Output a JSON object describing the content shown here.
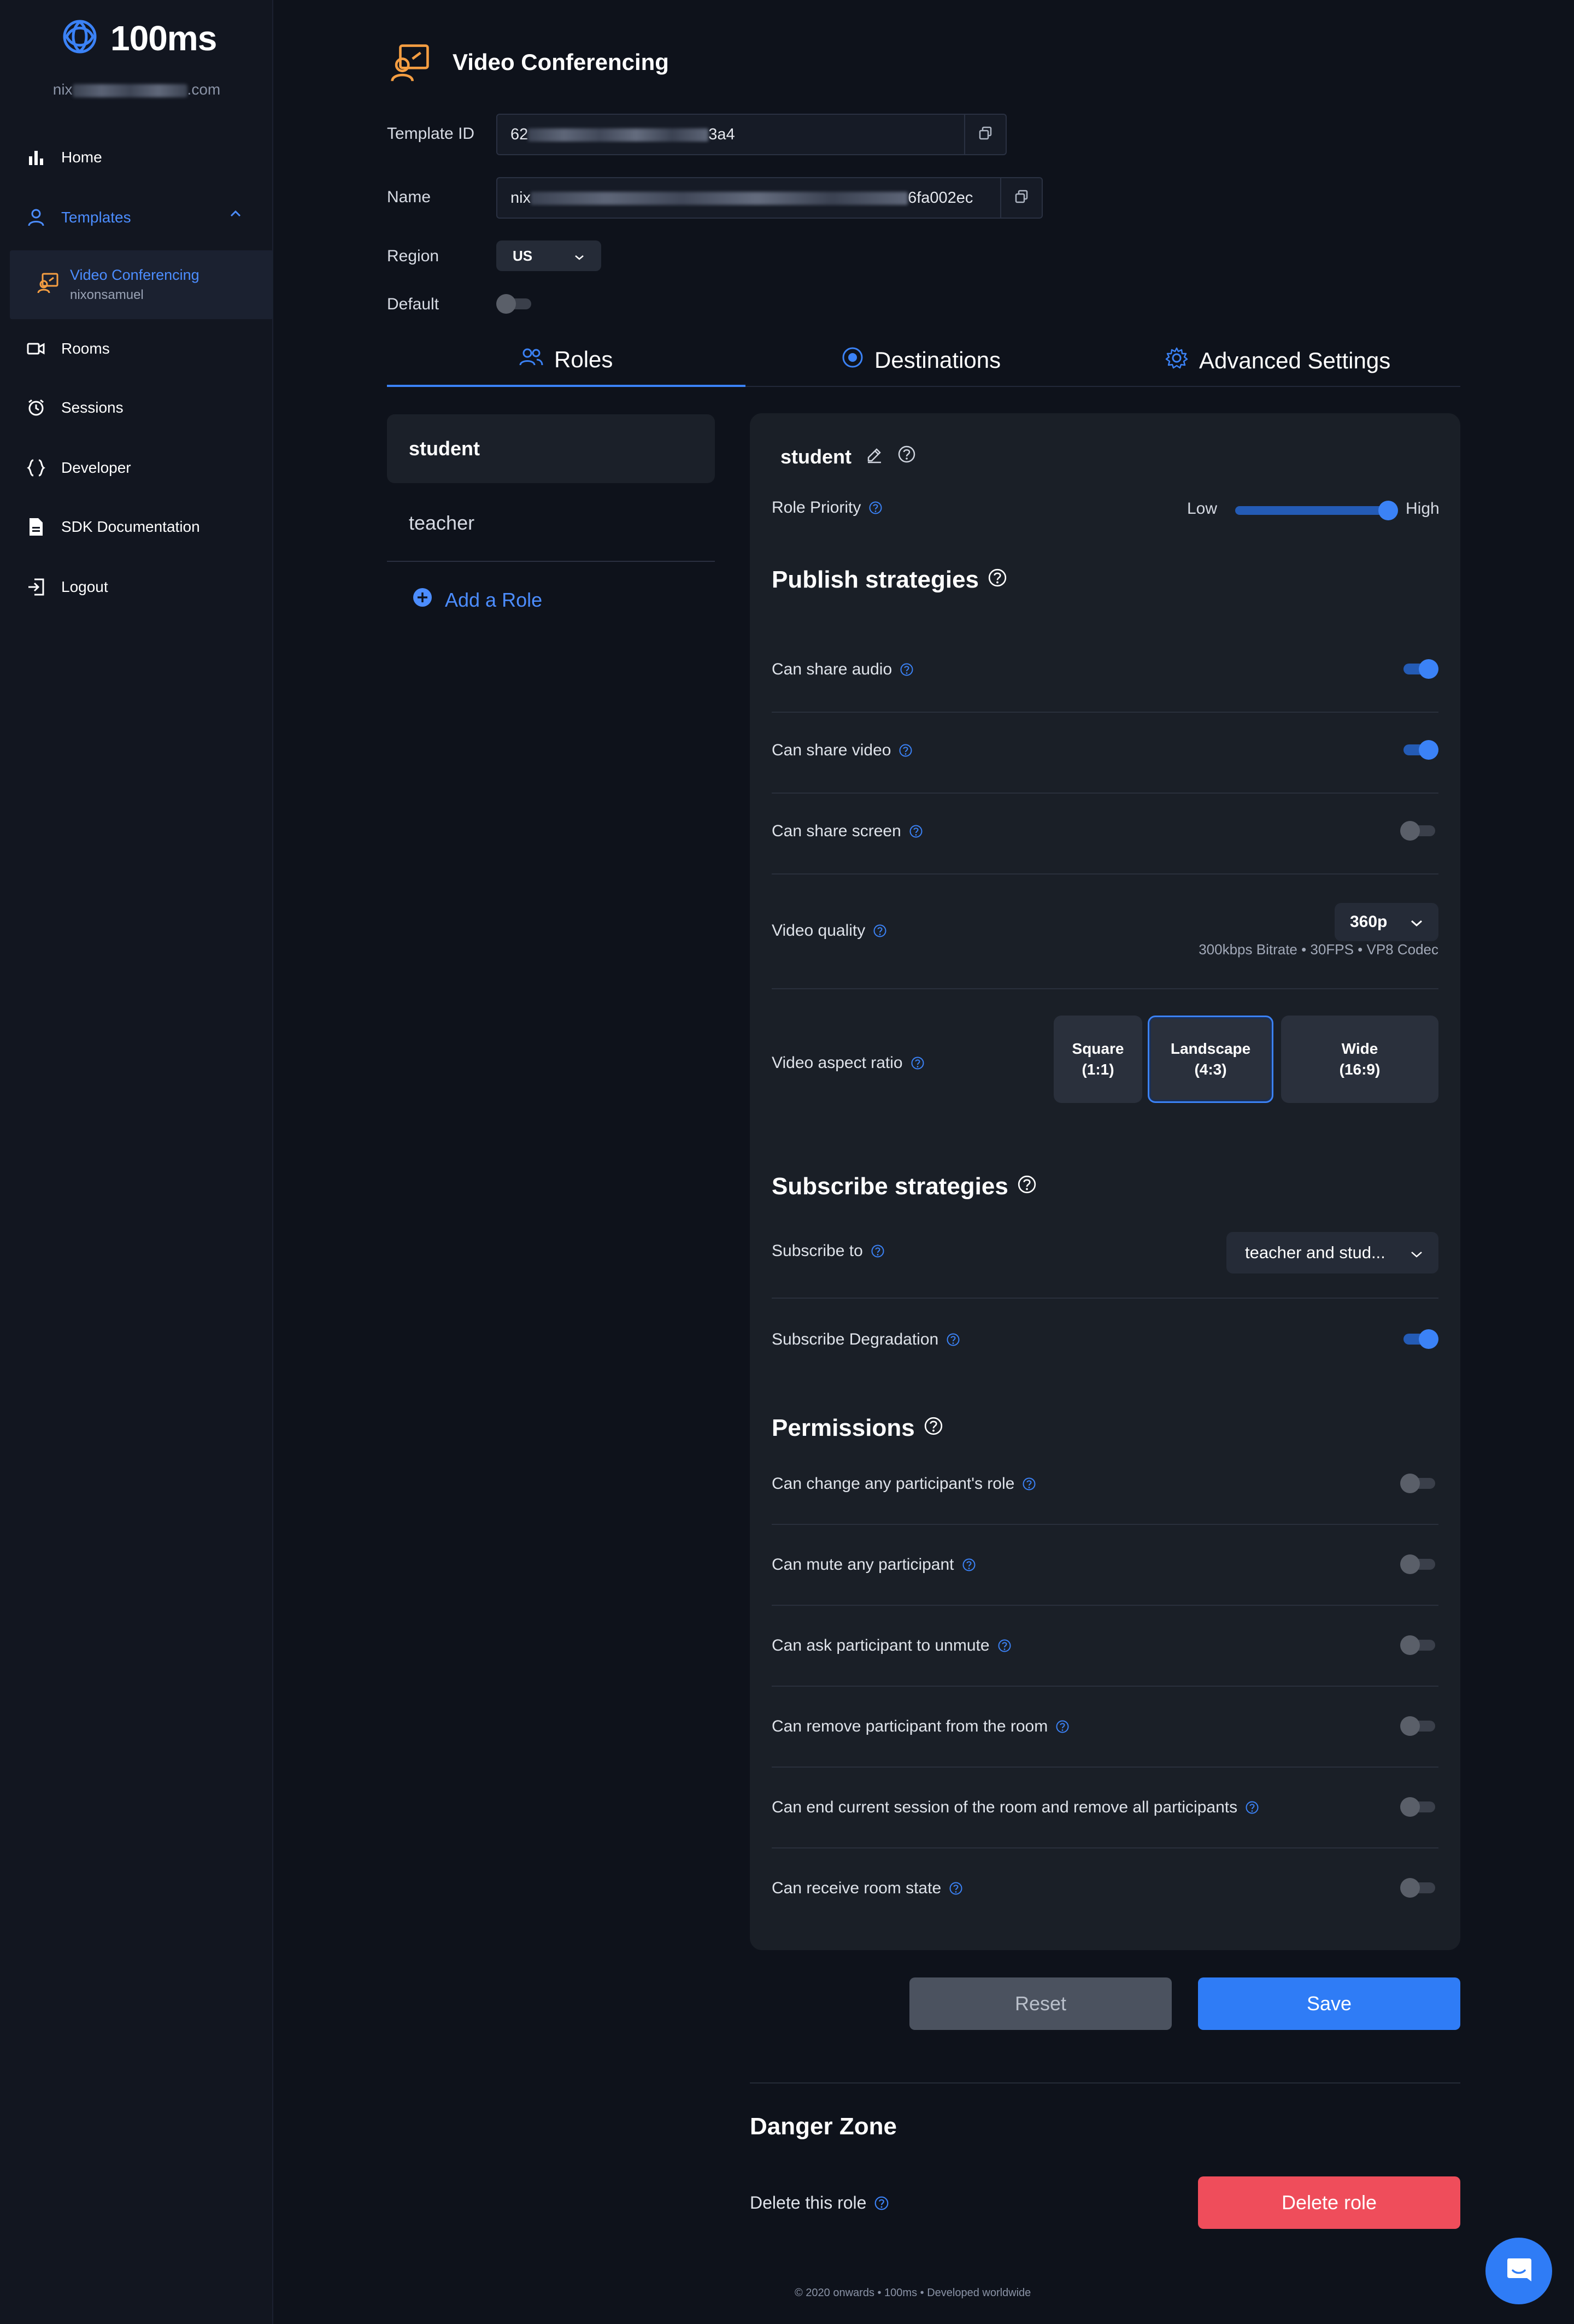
{
  "colors": {
    "accent": "#3b82f6",
    "danger": "#ef4d5b",
    "brand_icon": "#f59e42",
    "background": "#0e121b",
    "panel": "#1a1f27"
  },
  "sidebar": {
    "brand": "100ms",
    "email_prefix": "nix",
    "email_suffix": ".com",
    "items": [
      {
        "label": "Home",
        "icon": "bar-chart-icon"
      },
      {
        "label": "Templates",
        "icon": "user-icon"
      },
      {
        "label": "Rooms",
        "icon": "video-icon"
      },
      {
        "label": "Sessions",
        "icon": "alarm-clock-icon"
      },
      {
        "label": "Developer",
        "icon": "braces-icon"
      },
      {
        "label": "SDK Documentation",
        "icon": "document-icon"
      },
      {
        "label": "Logout",
        "icon": "logout-icon"
      }
    ],
    "template_sub": {
      "title": "Video Conferencing",
      "owner": "nixonsamuel"
    }
  },
  "header": {
    "title": "Video Conferencing"
  },
  "fields": {
    "template_id_label": "Template ID",
    "template_id_prefix": "62",
    "template_id_suffix": "3a4",
    "name_label": "Name",
    "name_prefix": "nix",
    "name_suffix": "6fa002ec",
    "region_label": "Region",
    "region_value": "US",
    "default_label": "Default",
    "default_on": false
  },
  "tabs": [
    {
      "label": "Roles",
      "icon": "users-icon",
      "active": true
    },
    {
      "label": "Destinations",
      "icon": "record-icon",
      "active": false
    },
    {
      "label": "Advanced Settings",
      "icon": "gear-icon",
      "active": false
    }
  ],
  "roles": {
    "items": [
      "student",
      "teacher"
    ],
    "selected": "student",
    "add_label": "Add a Role"
  },
  "role_panel": {
    "role_name": "student",
    "priority": {
      "label": "Role Priority",
      "low": "Low",
      "high": "High",
      "level": 1.0
    },
    "publish": {
      "title": "Publish strategies",
      "can_share_audio": {
        "label": "Can share audio",
        "on": true
      },
      "can_share_video": {
        "label": "Can share video",
        "on": true
      },
      "can_share_screen": {
        "label": "Can share screen",
        "on": false
      },
      "video_quality": {
        "label": "Video quality",
        "value": "360p",
        "info": "300kbps Bitrate • 30FPS • VP8 Codec"
      },
      "aspect_ratio": {
        "label": "Video aspect ratio",
        "options": [
          {
            "line1": "Square",
            "line2": "(1:1)"
          },
          {
            "line1": "Landscape",
            "line2": "(4:3)"
          },
          {
            "line1": "Wide",
            "line2": "(16:9)"
          }
        ],
        "selected": "Landscape"
      }
    },
    "subscribe": {
      "title": "Subscribe strategies",
      "subscribe_to": {
        "label": "Subscribe to",
        "value": "teacher and stud..."
      },
      "degradation": {
        "label": "Subscribe Degradation",
        "on": true
      }
    },
    "permissions": {
      "title": "Permissions",
      "items": [
        {
          "label": "Can change any participant's role",
          "on": false
        },
        {
          "label": "Can mute any participant",
          "on": false
        },
        {
          "label": "Can ask participant to unmute",
          "on": false
        },
        {
          "label": "Can remove participant from the room",
          "on": false
        },
        {
          "label": "Can end current session of the room and remove all participants",
          "on": false
        },
        {
          "label": "Can receive room state",
          "on": false
        }
      ]
    }
  },
  "actions": {
    "reset": "Reset",
    "save": "Save"
  },
  "danger_zone": {
    "title": "Danger Zone",
    "label": "Delete this role",
    "button": "Delete role"
  },
  "footer": {
    "text": "© 2020 onwards • 100ms • Developed worldwide"
  }
}
